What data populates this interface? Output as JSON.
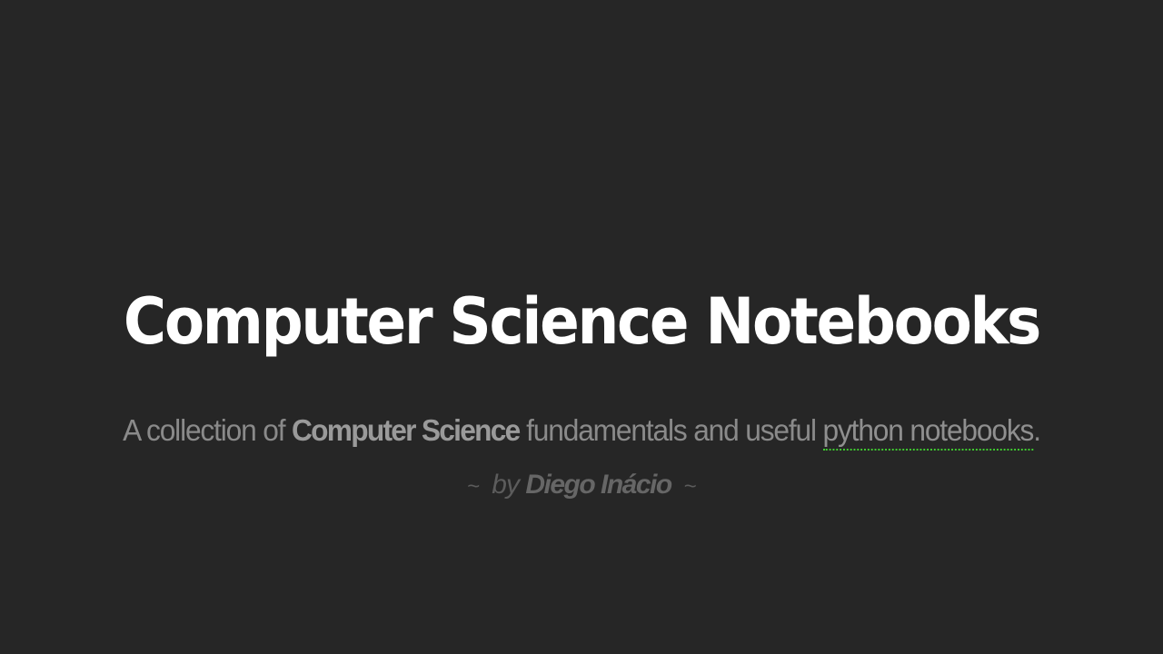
{
  "title": "Computer Science Notebooks",
  "subtitle": {
    "prefix": "A collection of ",
    "emphasis": "Computer Science",
    "middle": " fundamentals and useful ",
    "link_text": "python notebooks",
    "suffix": "."
  },
  "byline": {
    "tilde_left": "~",
    "by": "by",
    "author": "Diego Inácio",
    "tilde_right": "~"
  },
  "colors": {
    "background": "#262626",
    "title": "#ffffff",
    "subtitle": "#8a8a8a",
    "link_underline": "#3fcf2f"
  }
}
